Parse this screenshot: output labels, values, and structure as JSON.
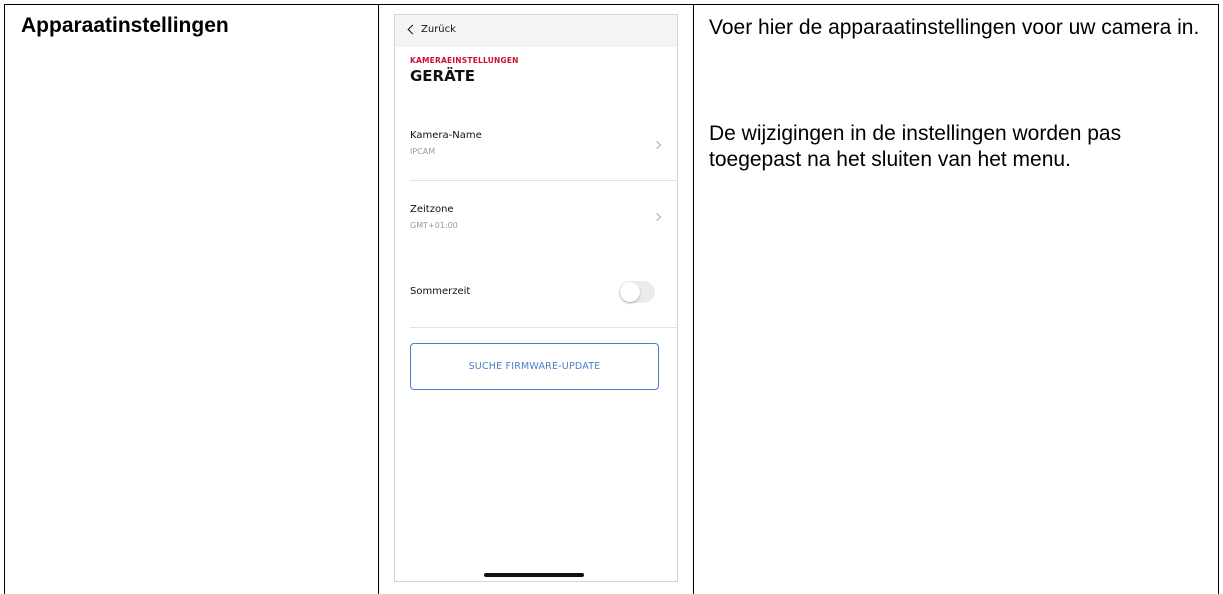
{
  "left_cell": {
    "title": "Apparaatinstellingen"
  },
  "right_cell": {
    "paragraph1": "Voer hier de apparaatinstellingen voor uw camera in.",
    "paragraph2": "De wijzigingen in de instellingen worden pas toegepast na het sluiten van het menu."
  },
  "phone": {
    "back_label": "Zurück",
    "eyebrow": "KAMERAEINSTELLUNGEN",
    "title": "GERÄTE",
    "camera_name": {
      "label": "Kamera-Name",
      "value": "IPCAM"
    },
    "timezone": {
      "label": "Zeitzone",
      "value": "GMT+01:00"
    },
    "dst": {
      "label": "Sommerzeit",
      "enabled": false
    },
    "firmware_button": "SUCHE FIRMWARE-UPDATE",
    "colors": {
      "accent_red": "#c8102e",
      "button_blue": "#4a7ec8"
    }
  }
}
